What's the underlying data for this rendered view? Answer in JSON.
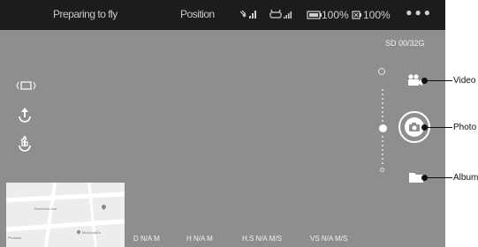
{
  "topbar": {
    "status": "Preparing to fly",
    "mode": "Position",
    "drone_battery": "100%",
    "controller_battery": "100%",
    "more_icon": "more-dots-icon"
  },
  "storage": "SD 00/32G",
  "left_controls": [
    "aspect-ratio-icon",
    "takeoff-icon",
    "return-home-icon"
  ],
  "right_controls": {
    "video": {
      "icon": "video-camera-icon",
      "callout": "Video"
    },
    "photo": {
      "icon": "camera-icon",
      "callout": "Photo"
    },
    "album": {
      "icon": "folder-icon",
      "callout": "Album"
    }
  },
  "map": {
    "labels": [
      "Northrock Ave",
      "McDonald's",
      "Pinnacle"
    ]
  },
  "telemetry": {
    "distance": "D N/A M",
    "height": "H N/A M",
    "horizontal_speed": "H.S N/A M/S",
    "vertical_speed": "VS  N/A M/S"
  },
  "colors": {
    "topbar": "#1c1c1c",
    "viewport": "#8e8e8e",
    "accent": "#ffffff"
  }
}
